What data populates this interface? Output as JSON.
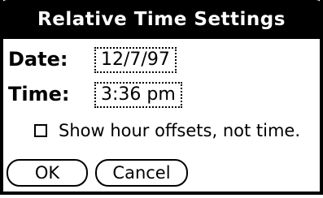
{
  "dialog": {
    "title": "Relative Time Settings",
    "date_label": "Date:",
    "date_value": "12/7/97",
    "time_label": "Time:",
    "time_value": "3:36 pm",
    "checkbox_label": "Show hour offsets, not time.",
    "checkbox_checked": false,
    "ok_label": "OK",
    "cancel_label": "Cancel"
  }
}
